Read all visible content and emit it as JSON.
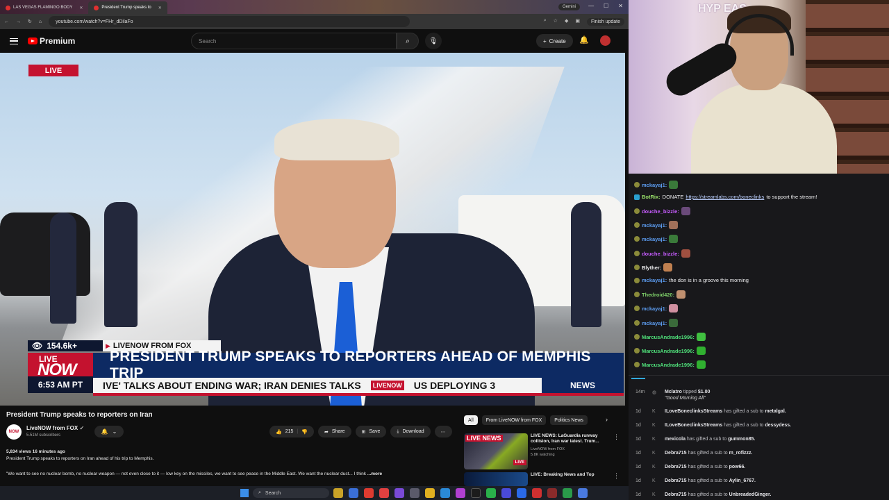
{
  "browser": {
    "tabs": [
      {
        "label": "LAS VEGAS FLAMINGO BODY",
        "active": false
      },
      {
        "label": "President Trump speaks to",
        "active": true
      }
    ],
    "gemini_label": "Gemini",
    "url": "youtube.com/watch?v=FHr_dDilaFo",
    "finish_update_label": "Finish update"
  },
  "youtube": {
    "logo_text": "Premium",
    "search_placeholder": "Search",
    "create_label": "Create"
  },
  "video": {
    "live_label": "LIVE",
    "viewers": "154.6k+",
    "source": "LIVENOW FROM FOX",
    "now_live": "LIVE",
    "now_big": "NOW",
    "time": "6:53 AM PT",
    "headline": "PRESIDENT TRUMP SPEAKS TO REPORTERS AHEAD OF MEMPHIS TRIP",
    "ticker_left": "IVE' TALKS ABOUT ENDING WAR; IRAN DENIES TALKS",
    "ticker_logo": "LIVENOW",
    "ticker_right": "US DEPLOYING 3",
    "news_label": "NEWS"
  },
  "below": {
    "title": "President Trump speaks to reporters on Iran",
    "channel": "LiveNOW from FOX",
    "channel_avatar": "NOW",
    "subscribers": "5.51M subscribers",
    "likes": "215",
    "share_label": "Share",
    "save_label": "Save",
    "download_label": "Download",
    "meta": "5,834 views  16 minutes ago",
    "desc_line1": "President Trump speaks to reporters on Iran ahead of his trip to Memphis.",
    "desc_line2": "\"We want to see no nuclear bomb, no nuclear weapon — not even close to it — low key on the missiles, we want to see peace in the Middle East. We want the nuclear dust... I think",
    "more_label": "...more",
    "chips": [
      "All",
      "From LiveNOW from FOX",
      "Politics News"
    ],
    "recs": [
      {
        "tag": "LIVE NEWS",
        "badge": "LIVE",
        "title": "LIVE NEWS: LaGuardia runway collision, Iran war latest. Trum...",
        "channel": "LiveNOW from FOX",
        "views": "5.8K watching"
      },
      {
        "tag": "",
        "badge": "",
        "title": "LIVE: Breaking News and Top",
        "channel": "",
        "views": ""
      }
    ]
  },
  "taskbar": {
    "search_label": "Search"
  },
  "cam": {
    "sign_text": "HYP EAS"
  },
  "chat": [
    {
      "user": "mckayaj1:",
      "color": "#5c9cf0",
      "text": "",
      "emote": "#3a7a3a"
    },
    {
      "user": "BotRix:",
      "color": "#9ce46b",
      "text": "DONATE",
      "link": "https://streamlabs.com/boneclinks",
      "suffix": "to support the stream!",
      "emote": ""
    },
    {
      "user": "douche_bizzle:",
      "color": "#c75cff",
      "text": "",
      "emote": "#6a4a7a"
    },
    {
      "user": "mckayaj1:",
      "color": "#5c9cf0",
      "text": "",
      "emote": "#a0705a"
    },
    {
      "user": "mckayaj1:",
      "color": "#5c9cf0",
      "text": "",
      "emote": "#3a7a3a"
    },
    {
      "user": "douche_bizzle:",
      "color": "#c75cff",
      "text": "",
      "emote": "#a05040"
    },
    {
      "user": "Blyther:",
      "color": "#efeff1",
      "text": "",
      "emote": "#c08050"
    },
    {
      "user": "mckayaj1:",
      "color": "#5c9cf0",
      "text": "the don is in a groove this morning",
      "emote": ""
    },
    {
      "user": "Thedroid420:",
      "color": "#7fd06a",
      "text": "",
      "emote": "#c09070"
    },
    {
      "user": "mckayaj1:",
      "color": "#5c9cf0",
      "text": "",
      "emote": "#d090a0"
    },
    {
      "user": "mckayaj1:",
      "color": "#5c9cf0",
      "text": "",
      "emote": "#3a6a3a"
    },
    {
      "user": "MarcusAndrade1996:",
      "color": "#4fe07a",
      "text": "",
      "emote": "#40c040"
    },
    {
      "user": "MarcusAndrade1996:",
      "color": "#4fe07a",
      "text": "",
      "emote": "#30b030"
    },
    {
      "user": "MarcusAndrade1996:",
      "color": "#4fe07a",
      "text": "",
      "emote": "#30b030"
    }
  ],
  "events": [
    {
      "age": "14m",
      "who": "Mclatro",
      "action": "tipped",
      "target": "$1.00",
      "note": "\"Good Morning All\""
    },
    {
      "age": "1d",
      "who": "ILoveBoneclinksStreams",
      "action": "has gifted a sub to",
      "target": "metalgal."
    },
    {
      "age": "1d",
      "who": "ILoveBoneclinksStreams",
      "action": "has gifted a sub to",
      "target": "dessydess."
    },
    {
      "age": "1d",
      "who": "mexicola",
      "action": "has gifted a sub to",
      "target": "gummon85."
    },
    {
      "age": "1d",
      "who": "Debra715",
      "action": "has gifted a sub to",
      "target": "m_rofizzz."
    },
    {
      "age": "1d",
      "who": "Debra715",
      "action": "has gifted a sub to",
      "target": "pow66."
    },
    {
      "age": "1d",
      "who": "Debra715",
      "action": "has gifted a sub to",
      "target": "Aylin_6767."
    },
    {
      "age": "1d",
      "who": "Debra715",
      "action": "has gifted a sub to",
      "target": "UnbreadedGinger."
    }
  ]
}
